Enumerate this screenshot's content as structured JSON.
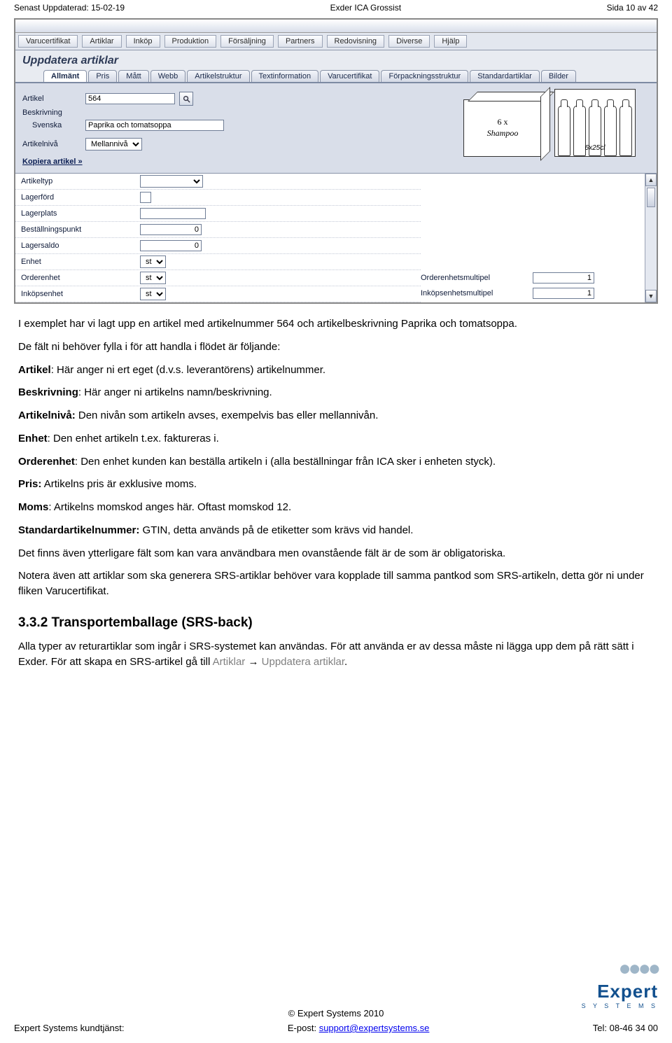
{
  "doc": {
    "left": "Senast Uppdaterad: 15-02-19",
    "center": "Exder ICA Grossist",
    "right": "Sida 10 av 42"
  },
  "menu": [
    "Varucertifikat",
    "Artiklar",
    "Inköp",
    "Produktion",
    "Försäljning",
    "Partners",
    "Redovisning",
    "Diverse",
    "Hjälp"
  ],
  "winTitle": "Uppdatera artiklar",
  "tabs": [
    "Allmänt",
    "Pris",
    "Mått",
    "Webb",
    "Artikelstruktur",
    "Textinformation",
    "Varucertifikat",
    "Förpackningsstruktur",
    "Standardartiklar",
    "Bilder"
  ],
  "form": {
    "artikel_lab": "Artikel",
    "artikel_val": "564",
    "beskr_lab": "Beskrivning",
    "beskr_lang": "Svenska",
    "beskr_val": "Paprika och tomatsoppa",
    "niva_lab": "Artikelnivå",
    "niva_val": "Mellannivå",
    "kopiera": "Kopiera artikel »"
  },
  "box": {
    "l1": "6 x",
    "l2": "Shampoo"
  },
  "bottles": {
    "lbl": "6x25cl"
  },
  "grid": {
    "artikeltyp": "Artikeltyp",
    "lagerford": "Lagerförd",
    "lagerplats": "Lagerplats",
    "bestpunkt": "Beställningspunkt",
    "bestpunkt_v": "0",
    "lagersaldo": "Lagersaldo",
    "lagersaldo_v": "0",
    "enhet": "Enhet",
    "enhet_v": "st",
    "orderenhet": "Orderenhet",
    "orderenhet_v": "st",
    "inkopsenhet": "Inköpsenhet",
    "inkopsenhet_v": "st",
    "ordermult": "Orderenhetsmultipel",
    "ordermult_v": "1",
    "inkopmult": "Inköpsenhetsmultipel",
    "inkopmult_v": "1"
  },
  "text": {
    "p1": "I exemplet har vi lagt upp en artikel med artikelnummer 564 och artikelbeskrivning Paprika och tomatsoppa.",
    "p2": "De fält ni behöver fylla i för att handla i flödet är följande:",
    "p3a": "Artikel",
    "p3b": ": Här anger ni ert eget (d.v.s. leverantörens) artikelnummer.",
    "p4a": "Beskrivning",
    "p4b": ": Här anger ni artikelns namn/beskrivning.",
    "p5a": "Artikelnivå:",
    "p5b": " Den nivån som artikeln avses, exempelvis bas eller mellannivån.",
    "p6a": "Enhet",
    "p6b": ": Den enhet artikeln t.ex. faktureras i.",
    "p7a": "Orderenhet",
    "p7b": ": Den enhet kunden kan beställa artikeln i (alla beställningar från ICA sker i enheten styck).",
    "p8a": "Pris:",
    "p8b": " Artikelns pris är exklusive moms.",
    "p9a": "Moms",
    "p9b": ": Artikelns momskod anges här. Oftast momskod 12.",
    "p10a": "Standardartikelnummer:",
    "p10b": " GTIN, detta används på de etiketter som krävs vid handel.",
    "p11": "Det finns även ytterligare fält som kan vara användbara men ovanstående fält är de som är obligatoriska.",
    "p12": "Notera även att artiklar som ska generera SRS-artiklar behöver vara kopplade till samma pantkod som SRS-artikeln, detta gör ni under fliken Varucertifikat.",
    "h": "3.3.2   Transportemballage (SRS-back)",
    "p13a": "Alla typer av returartiklar som ingår i SRS-systemet kan användas. För att använda er av dessa måste ni lägga upp dem på rätt sätt i Exder. För att skapa en SRS-artikel gå till ",
    "p13b": "Artiklar ",
    "arrow": "→ ",
    "p13c": "Uppdatera artiklar",
    "p13d": "."
  },
  "footer": {
    "copy": "© Expert Systems 2010",
    "left": "Expert Systems kundtjänst:",
    "midlab": "E-post: ",
    "midlink": "support@expertsystems.se",
    "right": "Tel: 08-46 34 00",
    "logoWord": "Expert",
    "logoSub": "S Y S T E M S"
  }
}
